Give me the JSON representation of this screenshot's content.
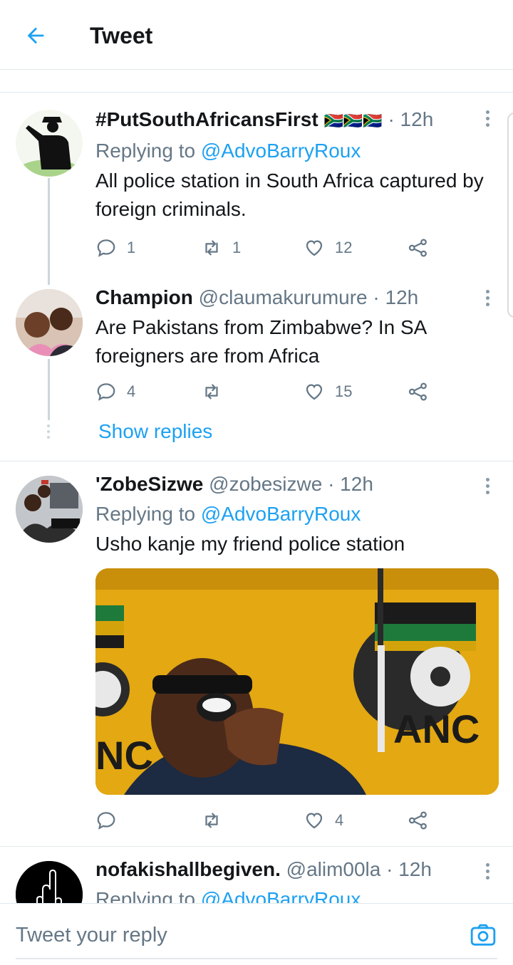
{
  "header": {
    "title": "Tweet"
  },
  "tweets": [
    {
      "name": "#PutSouthAfricansFirst",
      "handle": "",
      "flags": "🇿🇦🇿🇦🇿🇦",
      "time": "· 12h",
      "replying_prefix": "Replying to",
      "replying_to": "@AdvoBarryRoux",
      "text": "All police station in South Africa captured by foreign criminals.",
      "replies": "1",
      "retweets": "1",
      "likes": "12"
    },
    {
      "name": "Champion",
      "handle": "@claumakurumure",
      "time": "· 12h",
      "text": "Are Pakistans from Zimbabwe? In SA foreigners are from Africa",
      "replies": "4",
      "retweets": "",
      "likes": "15"
    },
    {
      "name": "'ZobeSizwe",
      "handle": "@zobesizwe",
      "time": "· 12h",
      "replying_prefix": "Replying to",
      "replying_to": "@AdvoBarryRoux",
      "text": "Usho kanje my friend police station",
      "media_text_left": "NC",
      "media_text_right": "ANC",
      "replies": "",
      "retweets": "",
      "likes": "4"
    },
    {
      "name": "nofakishallbegiven.",
      "handle": "@alim00la",
      "time": "· 12h",
      "replying_prefix": "Replying to",
      "replying_to": "@AdvoBarryRoux"
    }
  ],
  "thread": {
    "show_replies": "Show replies"
  },
  "reply_bar": {
    "placeholder": "Tweet your reply"
  },
  "colors": {
    "accent": "#1da1f2",
    "muted": "#657786",
    "text": "#14171a",
    "border": "#e1e8ed"
  }
}
